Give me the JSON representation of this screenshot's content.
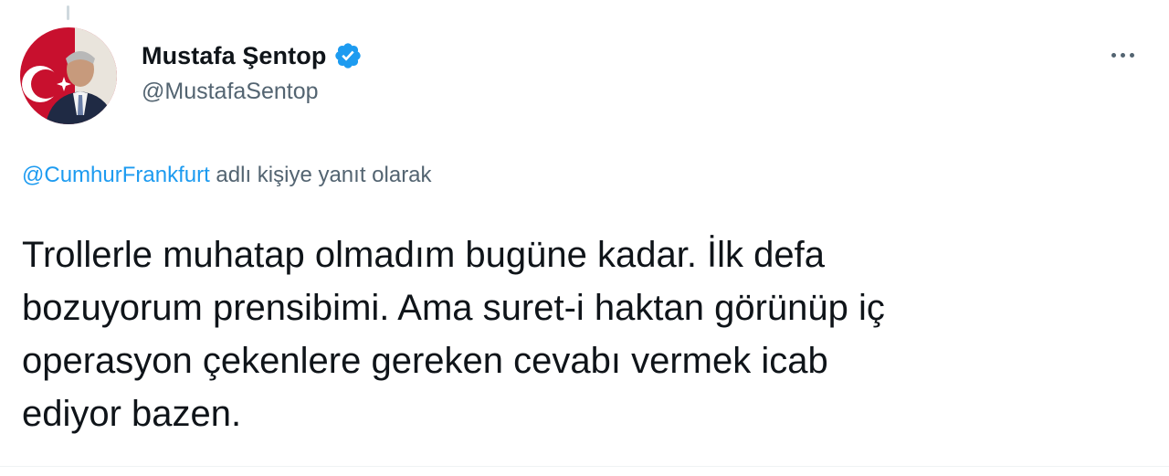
{
  "tweet": {
    "author": {
      "display_name": "Mustafa Şentop",
      "handle": "@MustafaSentop",
      "verified_icon": "verified-badge-icon",
      "avatar_icon": "avatar-photo"
    },
    "more_icon": "more-options-icon",
    "reply_to": {
      "mention": "@CumhurFrankfurt",
      "suffix": " adlı kişiye yanıt olarak"
    },
    "text_lines": [
      "Trollerle muhatap olmadım bugüne kadar. İlk defa",
      "bozuyorum prensibimi. Ama suret-i haktan görünüp iç",
      "operasyon çekenlere gereken cevabı vermek icab",
      "ediyor bazen."
    ],
    "colors": {
      "link": "#1d9bf0",
      "secondary_text": "#536471",
      "primary_text": "#0f1419",
      "verified": "#1d9bf0"
    }
  }
}
